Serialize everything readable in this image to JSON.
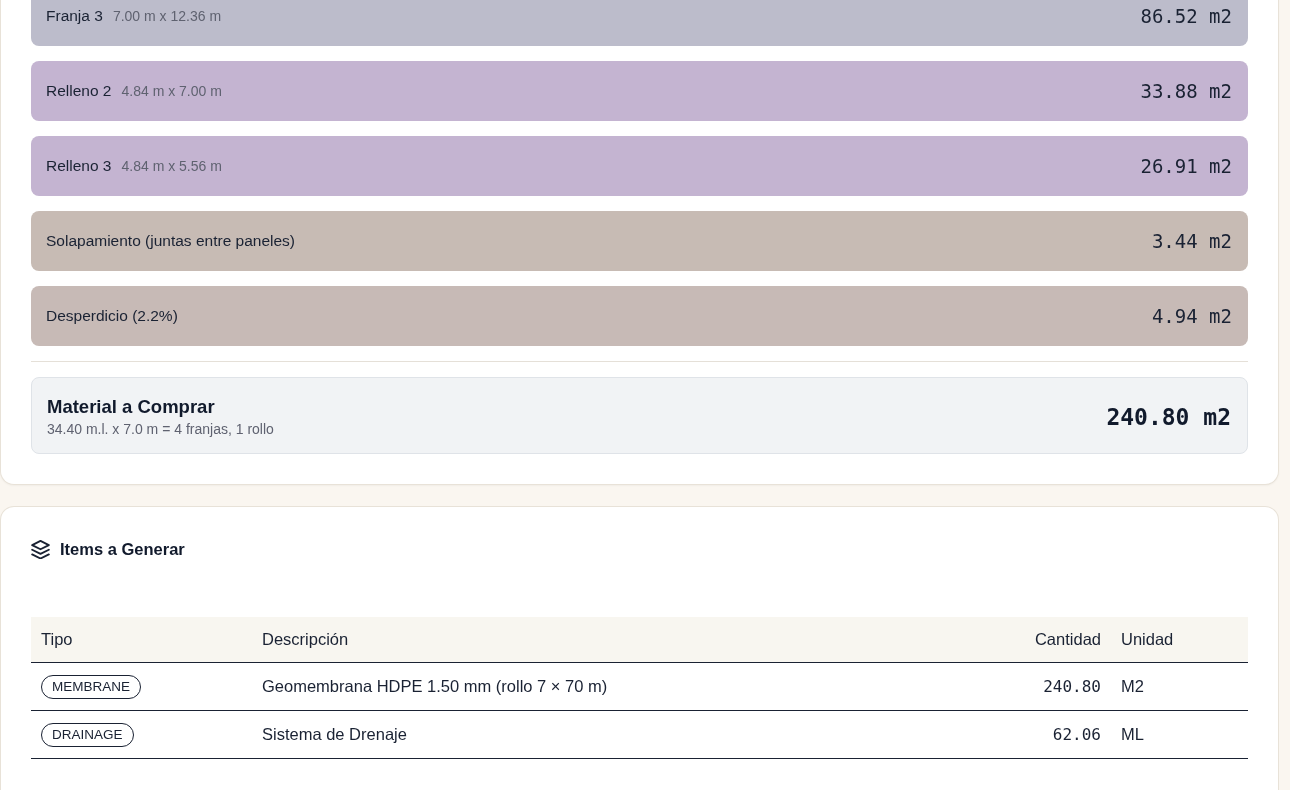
{
  "breakdown": {
    "rows": [
      {
        "label": "Franja 3",
        "dimensions": "7.00 m x 12.36 m",
        "area": "86.52 m2",
        "color": "#bcbccb"
      },
      {
        "label": "Relleno 2",
        "dimensions": "4.84 m x 7.00 m",
        "area": "33.88 m2",
        "color": "#c4b4d1"
      },
      {
        "label": "Relleno 3",
        "dimensions": "4.84 m x 5.56 m",
        "area": "26.91 m2",
        "color": "#c4b4d1"
      },
      {
        "label": "Solapamiento (juntas entre paneles)",
        "area": "3.44 m2",
        "color": "#c7bbb4"
      },
      {
        "label": "Desperdicio (2.2%)",
        "area": "4.94 m2",
        "color": "#c7bab6"
      }
    ],
    "total": {
      "title": "Material a Comprar",
      "detail": "34.40 m.l. x 7.0 m = 4 franjas, 1 rollo",
      "area": "240.80 m2"
    }
  },
  "items": {
    "title": "Items a Generar",
    "table": {
      "columns": [
        "Tipo",
        "Descripción",
        "Cantidad",
        "Unidad"
      ],
      "rows": [
        {
          "type": "MEMBRANE",
          "description": "Geomembrana HDPE 1.50 mm (rollo 7 × 70 m)",
          "quantity": "240.80",
          "unit": "M2"
        },
        {
          "type": "DRAINAGE",
          "description": "Sistema de Drenaje",
          "quantity": "62.06",
          "unit": "ML"
        }
      ]
    }
  }
}
